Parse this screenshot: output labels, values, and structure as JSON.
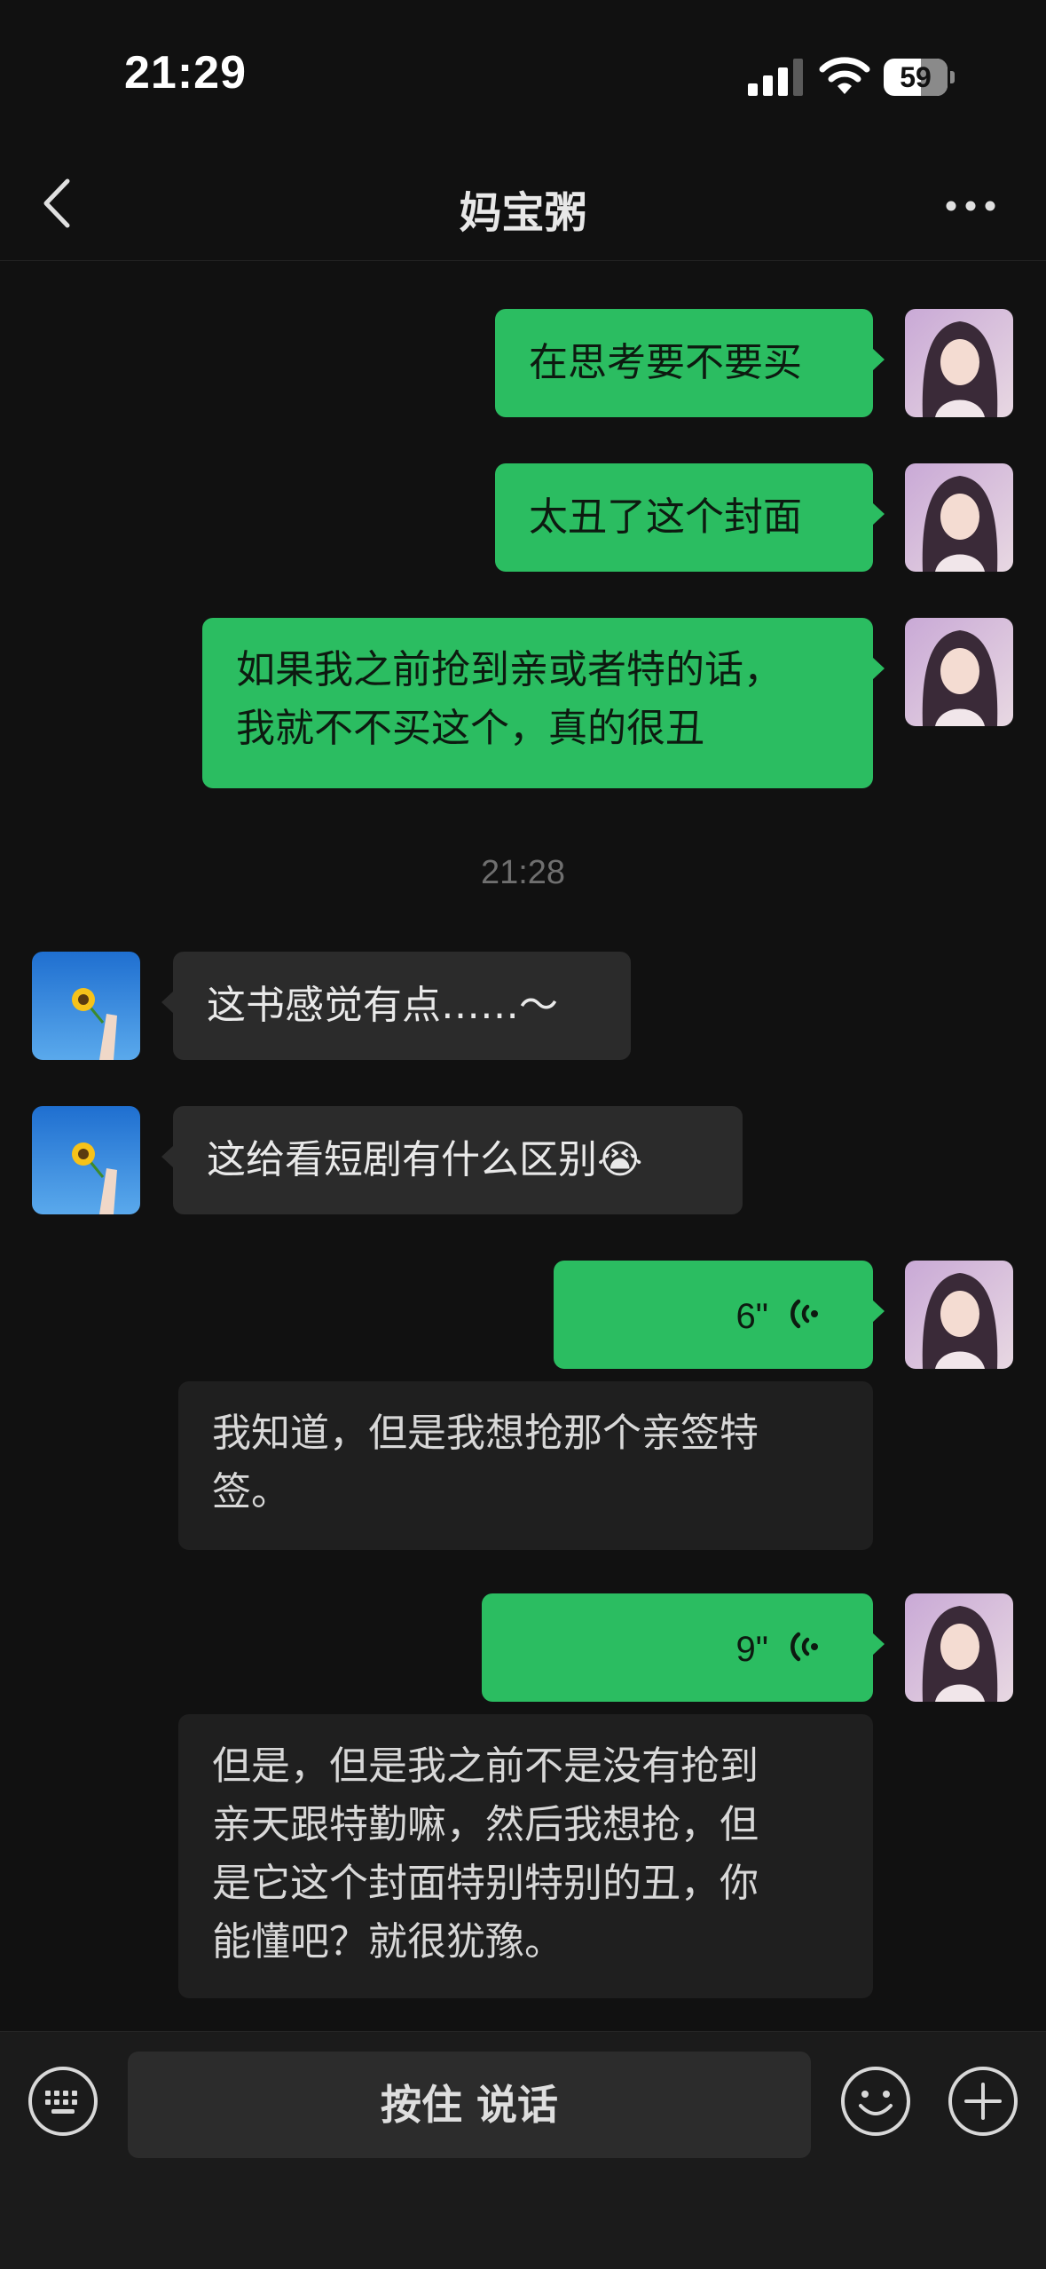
{
  "status_bar": {
    "time": "21:29",
    "battery": "59",
    "battery_percent": 59
  },
  "nav": {
    "title": "妈宝粥"
  },
  "messages": [
    {
      "sender": "me",
      "type": "text",
      "text": "在思考要不要买"
    },
    {
      "sender": "me",
      "type": "text",
      "text": "太丑了这个封面"
    },
    {
      "sender": "me",
      "type": "text",
      "text": "如果我之前抢到亲或者特的话，\n我就不不买这个，真的很丑"
    },
    {
      "sender": "other",
      "type": "text",
      "text": "这书感觉有点……～"
    },
    {
      "sender": "other",
      "type": "text",
      "text": "这给看短剧有什么区别😭"
    },
    {
      "sender": "me",
      "type": "voice",
      "duration": "6\"",
      "transcript": "我知道，但是我想抢那个亲签特\n签。"
    },
    {
      "sender": "me",
      "type": "voice",
      "duration": "9\"",
      "transcript": "但是，但是我之前不是没有抢到\n亲天跟特勤嘛，然后我想抢，但\n是它这个封面特别特别的丑，你\n能懂吧？就很犹豫。"
    }
  ],
  "time_divider": "21:28",
  "input_bar": {
    "hold_to_talk_label": "按住 说话"
  },
  "icons": {
    "back": "chevron-left-icon",
    "more": "more-dots-icon",
    "keyboard": "keyboard-icon",
    "emoji": "smiley-icon",
    "plus": "plus-icon",
    "voice": "voice-wave-icon"
  },
  "colors": {
    "background": "#111111",
    "my_bubble": "#2bbd61",
    "other_bubble": "#2b2b2b",
    "transcript_bg": "#1f1f1f",
    "input_bar": "#1b1b1b"
  }
}
